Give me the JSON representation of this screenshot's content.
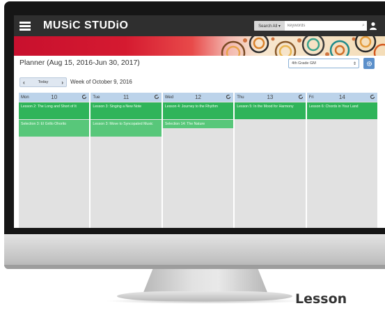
{
  "topbar": {
    "app_title": "MUSiC STUDiO",
    "search_scope": "Search All ▾",
    "search_placeholder": "keywords"
  },
  "planner": {
    "title": "Planner (Aug 15, 2016-Jun 30, 2017)",
    "grade_select": "4th Grade GM",
    "today_label": "Today",
    "week_label": "Week of October 9, 2016"
  },
  "calendar": {
    "days": [
      {
        "name": "Mon",
        "num": "10",
        "lessons": [
          {
            "text": "Lesson 2: The Long and Short of It",
            "kind": "dark"
          },
          {
            "text": "Selection 3: El Grillo Ohorito",
            "kind": "light"
          }
        ]
      },
      {
        "name": "Tue",
        "num": "11",
        "lessons": [
          {
            "text": "Lesson 3: Singing a New Note",
            "kind": "dark"
          },
          {
            "text": "Lesson 3: Move to Syncopated Music",
            "kind": "light"
          }
        ]
      },
      {
        "name": "Wed",
        "num": "12",
        "lessons": [
          {
            "text": "Lesson 4: Journey to the Rhythm",
            "kind": "dark"
          },
          {
            "text": "Selection 14: The Nature",
            "kind": "light"
          }
        ]
      },
      {
        "name": "Thu",
        "num": "13",
        "lessons": [
          {
            "text": "Lesson 5: In the Mood for Harmony",
            "kind": "dark"
          }
        ]
      },
      {
        "name": "Fri",
        "num": "14",
        "lessons": [
          {
            "text": "Lesson 6: Chords in Your Land",
            "kind": "dark"
          }
        ]
      }
    ]
  },
  "caption": "Lesson",
  "colors": {
    "lesson_dark": "#2fb45a",
    "lesson_light": "#58c77a",
    "banner_red": "#c8102e",
    "day_header": "#bcd3ea"
  }
}
